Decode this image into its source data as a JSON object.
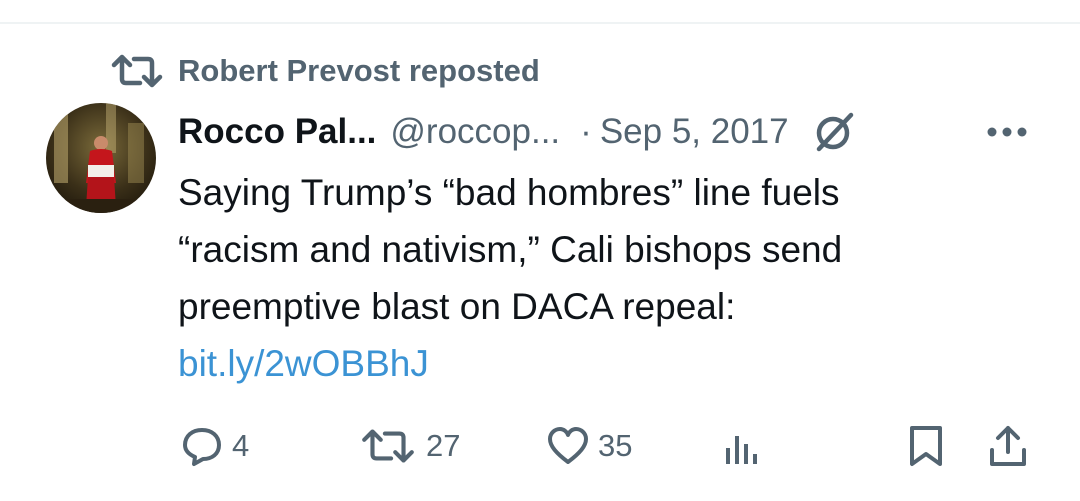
{
  "repost": {
    "label": "Robert Prevost reposted"
  },
  "tweet": {
    "display_name": "Rocco Pal...",
    "handle": "@roccop...",
    "separator": "·",
    "date": "Sep 5, 2017",
    "text_lines": [
      "Saying Trump’s “bad hombres” line fuels",
      "“racism and nativism,” Cali bishops send",
      "preemptive blast on DACA repeal:"
    ],
    "link": "bit.ly/2wOBBhJ"
  },
  "actions": {
    "replies": "4",
    "reposts": "27",
    "likes": "35"
  },
  "colors": {
    "secondary_text": "#536471",
    "link": "#3b93d4",
    "primary_text": "#0f1419"
  }
}
